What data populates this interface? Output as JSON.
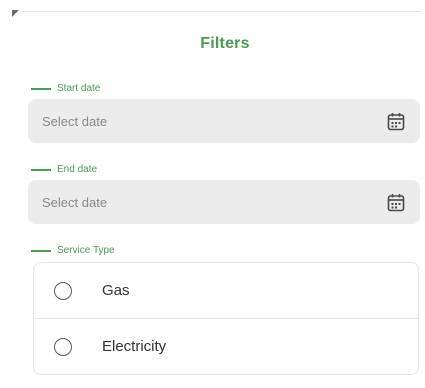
{
  "header": {
    "title": "Filters"
  },
  "start_date": {
    "label": "Start date",
    "placeholder": "Select date",
    "icon": "calendar-icon"
  },
  "end_date": {
    "label": "End date",
    "placeholder": "Select date",
    "icon": "calendar-icon"
  },
  "service_type": {
    "label": "Service Type",
    "options": [
      {
        "label": "Gas",
        "selected": false
      },
      {
        "label": "Electricity",
        "selected": false
      }
    ]
  },
  "colors": {
    "accent": "#4c9a55",
    "input_background": "#ececec",
    "placeholder_text": "#8a8a8a"
  }
}
